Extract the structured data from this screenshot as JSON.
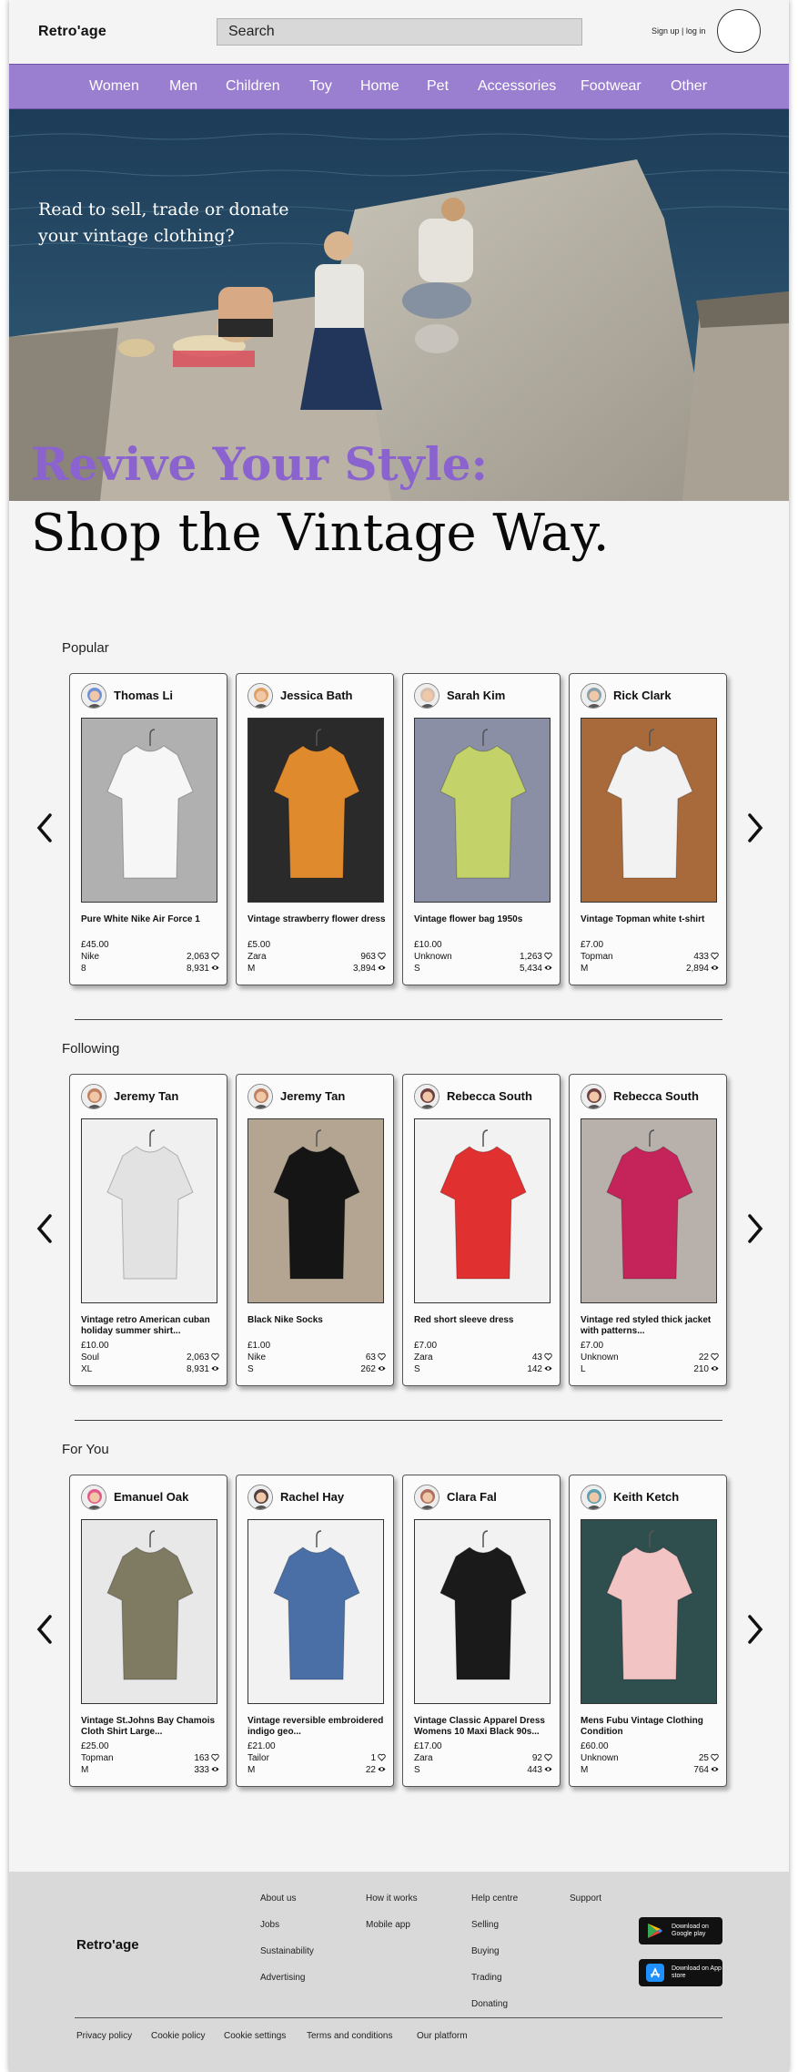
{
  "header": {
    "logo": "Retro'age",
    "search_placeholder": "Search",
    "signup_label": "Sign up | log in"
  },
  "nav": {
    "items": [
      "Women",
      "Men",
      "Children",
      "Toy",
      "Home",
      "Pet",
      "Accessories",
      "Footwear",
      "Other"
    ]
  },
  "hero": {
    "tagline": "Read to sell, trade or donate your vintage clothing?",
    "headline_accent": "Revive Your Style:",
    "headline_main": "Shop the Vintage Way."
  },
  "sections": [
    {
      "title": "Popular",
      "cards": [
        {
          "user": "Thomas Li",
          "title": "Pure White Nike Air Force 1",
          "price": "£45.00",
          "brand": "Nike",
          "likes": "2,063",
          "size": "8",
          "views": "8,931"
        },
        {
          "user": "Jessica Bath",
          "title": "Vintage strawberry flower dress",
          "price": "£5.00",
          "brand": "Zara",
          "likes": "963",
          "size": "M",
          "views": "3,894"
        },
        {
          "user": "Sarah Kim",
          "title": "Vintage flower bag 1950s",
          "price": "£10.00",
          "brand": "Unknown",
          "likes": "1,263",
          "size": "S",
          "views": "5,434"
        },
        {
          "user": "Rick Clark",
          "title": "Vintage Topman white t-shirt",
          "price": "£7.00",
          "brand": "Topman",
          "likes": "433",
          "size": "M",
          "views": "2,894"
        }
      ]
    },
    {
      "title": "Following",
      "cards": [
        {
          "user": "Jeremy Tan",
          "title": "Vintage retro American cuban holiday summer shirt...",
          "price": "£10.00",
          "brand": "Soul",
          "likes": "2,063",
          "size": "XL",
          "views": "8,931"
        },
        {
          "user": "Jeremy Tan",
          "title": "Black Nike Socks",
          "price": "£1.00",
          "brand": "Nike",
          "likes": "63",
          "size": "S",
          "views": "262"
        },
        {
          "user": "Rebecca South",
          "title": "Red short sleeve dress",
          "price": "£7.00",
          "brand": "Zara",
          "likes": "43",
          "size": "S",
          "views": "142"
        },
        {
          "user": "Rebecca South",
          "title": "Vintage red styled thick jacket with patterns...",
          "price": "£7.00",
          "brand": "Unknown",
          "likes": "22",
          "size": "L",
          "views": "210"
        }
      ]
    },
    {
      "title": "For You",
      "cards": [
        {
          "user": "Emanuel Oak",
          "title": "Vintage St.Johns Bay Chamois Cloth Shirt Large...",
          "price": "£25.00",
          "brand": "Topman",
          "likes": "163",
          "size": "M",
          "views": "333"
        },
        {
          "user": "Rachel Hay",
          "title": "Vintage reversible embroidered indigo geo...",
          "price": "£21.00",
          "brand": "Tailor",
          "likes": "1",
          "size": "M",
          "views": "22"
        },
        {
          "user": "Clara Fal",
          "title": "Vintage Classic Apparel Dress Womens 10 Maxi Black 90s...",
          "price": "£17.00",
          "brand": "Zara",
          "likes": "92",
          "size": "S",
          "views": "443"
        },
        {
          "user": "Keith Ketch",
          "title": "Mens Fubu Vintage Clothing Condition",
          "price": "£60.00",
          "brand": "Unknown",
          "likes": "25",
          "size": "M",
          "views": "764"
        }
      ]
    }
  ],
  "footer": {
    "logo": "Retro'age",
    "col1": [
      "About us",
      "Jobs",
      "Sustainability",
      "Advertising"
    ],
    "col2": [
      "How it works",
      "Mobile app"
    ],
    "col3": [
      "Help centre",
      "Selling",
      "Buying",
      "Trading",
      "Donating"
    ],
    "col4": [
      "Support"
    ],
    "google_play": "Download on Google play",
    "app_store": "Download on App store",
    "bottom_links": [
      "Privacy policy",
      "Cookie policy",
      "Cookie settings",
      "Terms and conditions",
      "Our platform"
    ]
  },
  "colors": {
    "nav_bg": "#9a7ed0",
    "accent_headline": "#8a63cf",
    "page_bg": "#f4f4f4",
    "footer_bg": "#d9d9d9"
  },
  "icons": {
    "like": "heart-icon",
    "views": "eye-icon",
    "prev": "chevron-left-icon",
    "next": "chevron-right-icon"
  }
}
